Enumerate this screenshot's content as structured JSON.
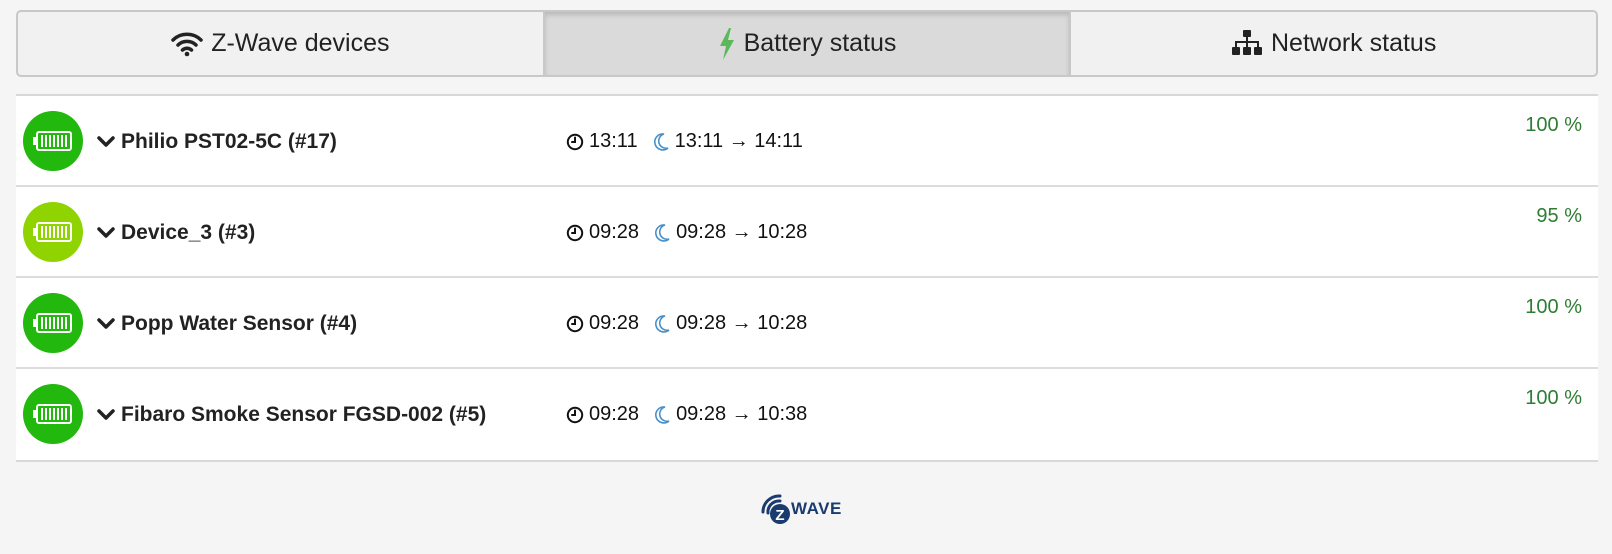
{
  "tabs": [
    {
      "label": "Z-Wave devices",
      "icon": "wifi-icon",
      "active": false
    },
    {
      "label": "Battery status",
      "icon": "bolt-icon",
      "active": true
    },
    {
      "label": "Network status",
      "icon": "sitemap-icon",
      "active": false
    }
  ],
  "devices": [
    {
      "name": "Philio PST02-5C (#17)",
      "last": "13:11",
      "wake": "13:11 → 14:11",
      "percent_label": "100 %",
      "percent": 100,
      "badge_color": "#22b80e"
    },
    {
      "name": "Device_3 (#3)",
      "last": "09:28",
      "wake": "09:28 → 10:28",
      "percent_label": "95 %",
      "percent": 95,
      "badge_color": "#8fd400"
    },
    {
      "name": "Popp Water Sensor (#4)",
      "last": "09:28",
      "wake": "09:28 → 10:28",
      "percent_label": "100 %",
      "percent": 100,
      "badge_color": "#22b80e"
    },
    {
      "name": "Fibaro Smoke Sensor FGSD-002 (#5)",
      "last": "09:28",
      "wake": "09:28 → 10:38",
      "percent_label": "100 %",
      "percent": 100,
      "badge_color": "#22b80e"
    }
  ],
  "footer": {
    "logo_text": "WAVE",
    "logo_letter": "Z"
  },
  "colors": {
    "percent_text": "#2e7d32",
    "bolt": "#5cb85c",
    "moon": "#4a90c8"
  }
}
